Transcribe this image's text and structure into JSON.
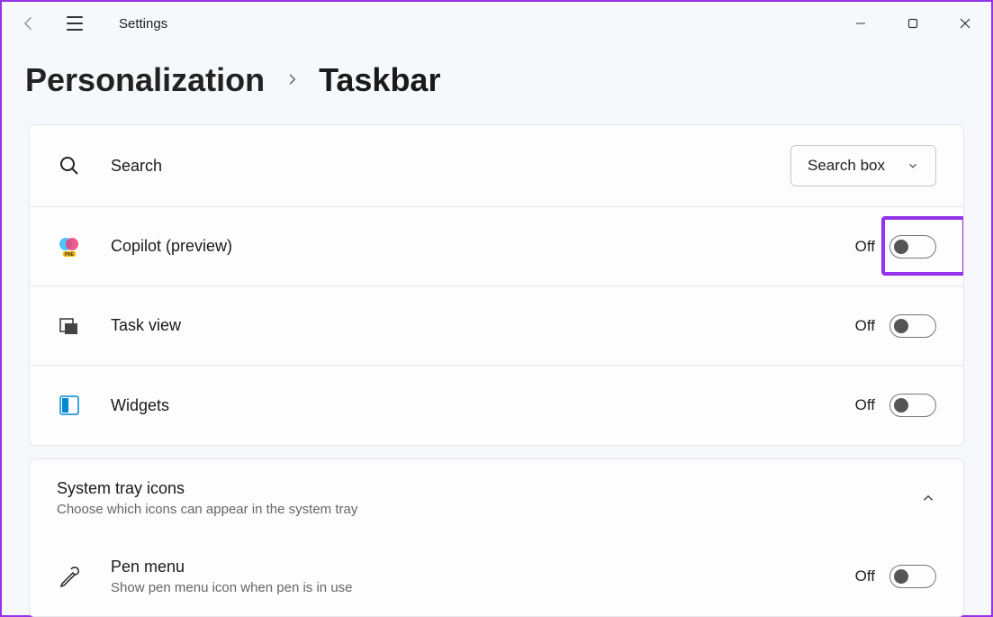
{
  "app": {
    "title": "Settings"
  },
  "breadcrumb": {
    "parent": "Personalization",
    "current": "Taskbar"
  },
  "items": {
    "search": {
      "label": "Search",
      "dropdown_value": "Search box"
    },
    "copilot": {
      "label": "Copilot (preview)",
      "state": "Off"
    },
    "taskview": {
      "label": "Task view",
      "state": "Off"
    },
    "widgets": {
      "label": "Widgets",
      "state": "Off"
    }
  },
  "section": {
    "title": "System tray icons",
    "subtitle": "Choose which icons can appear in the system tray"
  },
  "tray_items": {
    "pen": {
      "label": "Pen menu",
      "subtitle": "Show pen menu icon when pen is in use",
      "state": "Off"
    }
  }
}
